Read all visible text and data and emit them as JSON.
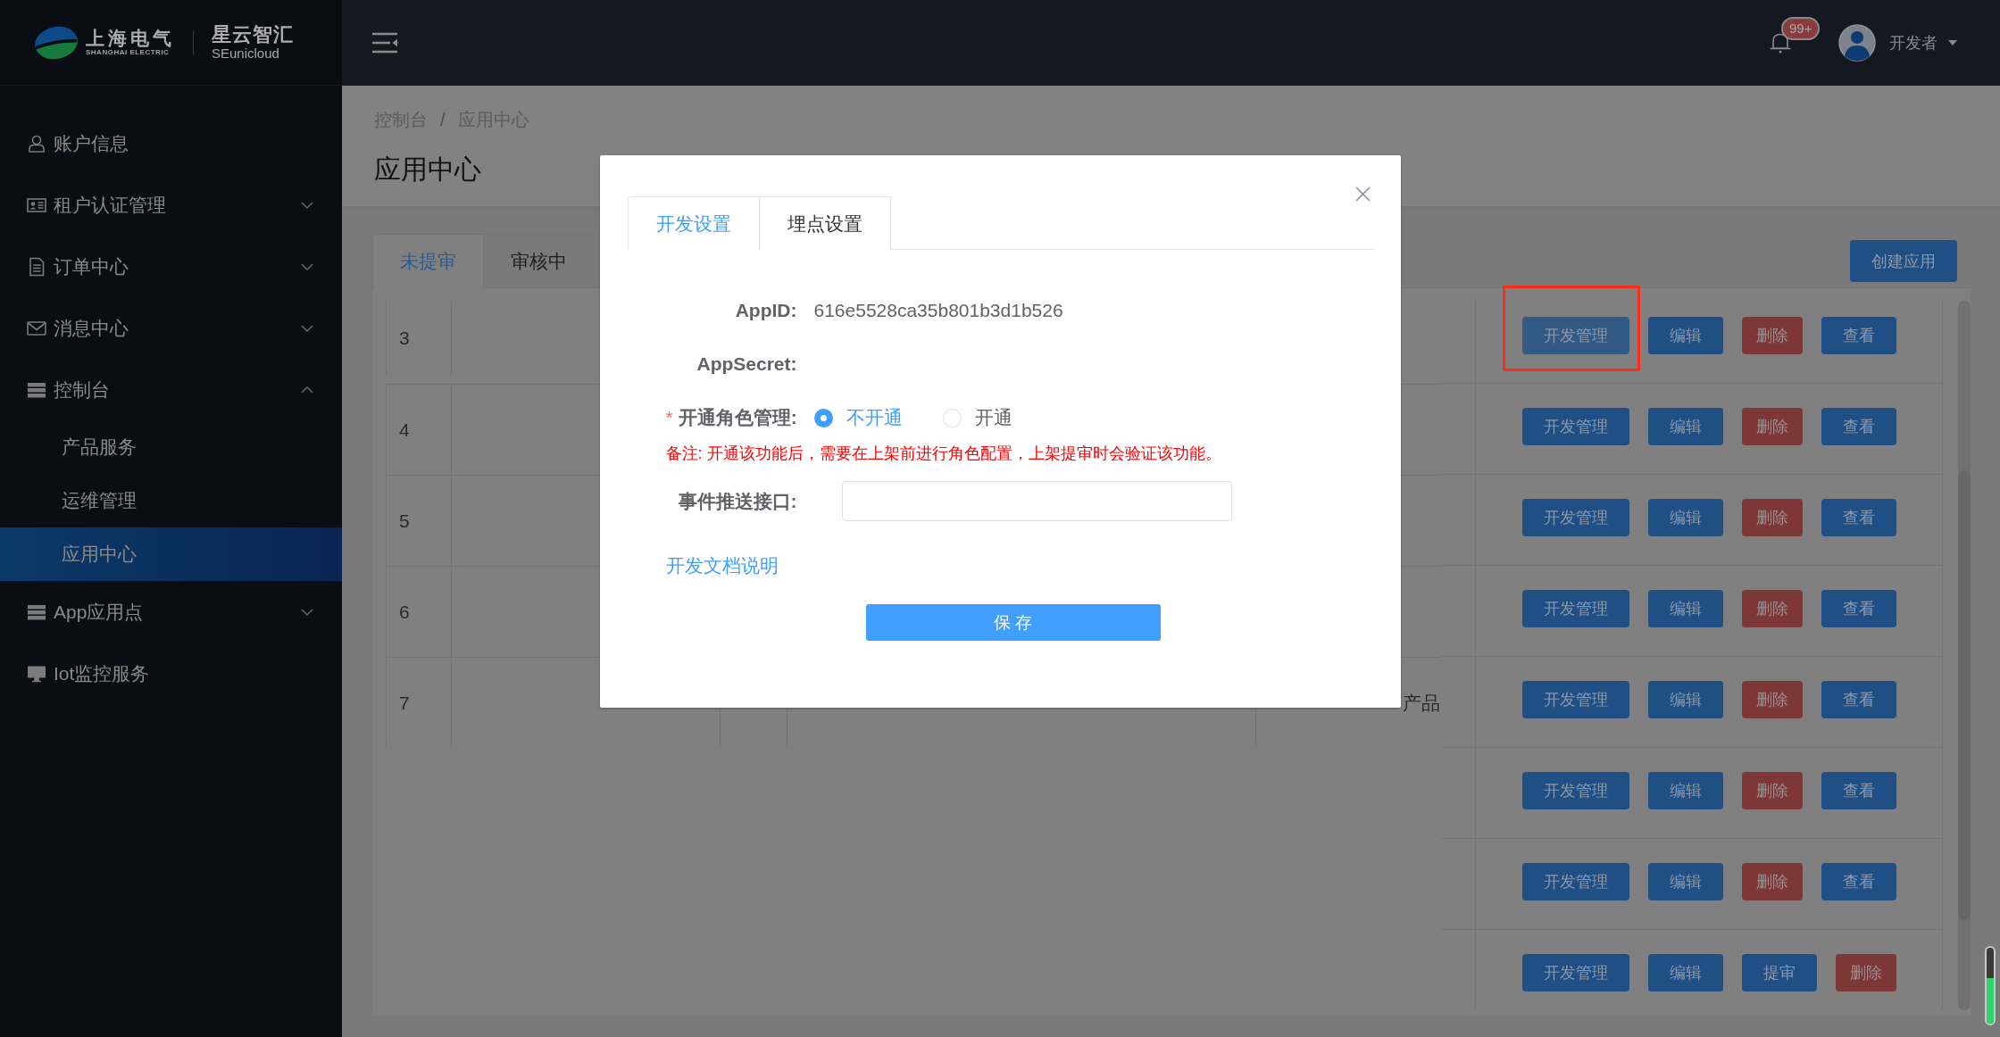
{
  "header": {
    "logo": {
      "brand": "上海电气",
      "brand_en": "SHANGHAI ELECTRIC",
      "product": "星云智汇",
      "product_en": "SEunicloud"
    },
    "notifications": {
      "badge": "99+"
    },
    "user": {
      "name": "开发者"
    }
  },
  "sidebar": {
    "items": [
      {
        "label": "账户信息",
        "kind": "link",
        "selected": false
      },
      {
        "label": "租户认证管理",
        "kind": "submenu",
        "expanded": false
      },
      {
        "label": "订单中心",
        "kind": "submenu",
        "expanded": false
      },
      {
        "label": "消息中心",
        "kind": "submenu",
        "expanded": false
      },
      {
        "label": "控制台",
        "kind": "submenu",
        "expanded": true,
        "children": [
          {
            "label": "产品服务",
            "selected": false
          },
          {
            "label": "运维管理",
            "selected": false
          },
          {
            "label": "应用中心",
            "selected": true
          }
        ]
      },
      {
        "label": "App应用点",
        "kind": "submenu",
        "expanded": false
      },
      {
        "label": "Iot监控服务",
        "kind": "link",
        "selected": false
      }
    ]
  },
  "breadcrumb": {
    "items": [
      "控制台",
      "应用中心"
    ],
    "separator": "/"
  },
  "page_title": "应用中心",
  "tabs": [
    {
      "label": "未提审",
      "selected": true
    },
    {
      "label": "审核中",
      "selected": false
    }
  ],
  "create_button": "创建应用",
  "table": {
    "rows": [
      {
        "column_1": "3"
      },
      {
        "column_1": "4"
      },
      {
        "column_1": "5"
      },
      {
        "column_1": "6"
      },
      {
        "column_1": "7",
        "column_5": "产品"
      }
    ],
    "action_rows": [
      {
        "actions": [
          {
            "label": "开发管理",
            "kind": "primary",
            "focused": true,
            "highlighted": true
          },
          {
            "label": "编辑",
            "kind": "primary",
            "focused": false,
            "highlighted": false
          },
          {
            "label": "删除",
            "kind": "danger",
            "focused": false,
            "highlighted": false
          },
          {
            "label": "查看",
            "kind": "primary",
            "focused": false,
            "highlighted": false
          }
        ]
      },
      {
        "actions": [
          {
            "label": "开发管理",
            "kind": "primary",
            "focused": false,
            "highlighted": false
          },
          {
            "label": "编辑",
            "kind": "primary",
            "focused": false,
            "highlighted": false
          },
          {
            "label": "删除",
            "kind": "danger",
            "focused": false,
            "highlighted": false
          },
          {
            "label": "查看",
            "kind": "primary",
            "focused": false,
            "highlighted": false
          }
        ]
      },
      {
        "actions": [
          {
            "label": "开发管理",
            "kind": "primary",
            "focused": false,
            "highlighted": false
          },
          {
            "label": "编辑",
            "kind": "primary",
            "focused": false,
            "highlighted": false
          },
          {
            "label": "删除",
            "kind": "danger",
            "focused": false,
            "highlighted": false
          },
          {
            "label": "查看",
            "kind": "primary",
            "focused": false,
            "highlighted": false
          }
        ]
      },
      {
        "actions": [
          {
            "label": "开发管理",
            "kind": "primary",
            "focused": false,
            "highlighted": false
          },
          {
            "label": "编辑",
            "kind": "primary",
            "focused": false,
            "highlighted": false
          },
          {
            "label": "删除",
            "kind": "danger",
            "focused": false,
            "highlighted": false
          },
          {
            "label": "查看",
            "kind": "primary",
            "focused": false,
            "highlighted": false
          }
        ]
      },
      {
        "actions": [
          {
            "label": "开发管理",
            "kind": "primary",
            "focused": false,
            "highlighted": false
          },
          {
            "label": "编辑",
            "kind": "primary",
            "focused": false,
            "highlighted": false
          },
          {
            "label": "删除",
            "kind": "danger",
            "focused": false,
            "highlighted": false
          },
          {
            "label": "查看",
            "kind": "primary",
            "focused": false,
            "highlighted": false
          }
        ]
      },
      {
        "actions": [
          {
            "label": "开发管理",
            "kind": "primary",
            "focused": false,
            "highlighted": false
          },
          {
            "label": "编辑",
            "kind": "primary",
            "focused": false,
            "highlighted": false
          },
          {
            "label": "删除",
            "kind": "danger",
            "focused": false,
            "highlighted": false
          },
          {
            "label": "查看",
            "kind": "primary",
            "focused": false,
            "highlighted": false
          }
        ]
      },
      {
        "actions": [
          {
            "label": "开发管理",
            "kind": "primary",
            "focused": false,
            "highlighted": false
          },
          {
            "label": "编辑",
            "kind": "primary",
            "focused": false,
            "highlighted": false
          },
          {
            "label": "删除",
            "kind": "danger",
            "focused": false,
            "highlighted": false
          },
          {
            "label": "查看",
            "kind": "primary",
            "focused": false,
            "highlighted": false
          }
        ]
      },
      {
        "actions": [
          {
            "label": "开发管理",
            "kind": "primary",
            "focused": false,
            "highlighted": false
          },
          {
            "label": "编辑",
            "kind": "primary",
            "focused": false,
            "highlighted": false
          },
          {
            "label": "提审",
            "kind": "primary",
            "focused": false,
            "highlighted": false
          },
          {
            "label": "删除",
            "kind": "danger",
            "focused": false,
            "highlighted": false
          }
        ]
      }
    ]
  },
  "dialog": {
    "tabs": [
      {
        "label": "开发设置",
        "selected": true
      },
      {
        "label": "埋点设置",
        "selected": false
      }
    ],
    "fields": [
      {
        "kind": "text",
        "label": "AppID:",
        "value": "616e5528ca35b801b3d1b526"
      },
      {
        "kind": "text",
        "label": "AppSecret:"
      },
      {
        "kind": "radio",
        "required_mark": "*",
        "label": "开通角色管理:",
        "options": [
          {
            "label": "不开通",
            "selected": true
          },
          {
            "label": "开通",
            "selected": false
          }
        ]
      },
      {
        "kind": "note",
        "text": "备注: 开通该功能后，需要在上架前进行角色配置，上架提审时会验证该功能。"
      },
      {
        "kind": "input",
        "label": "事件推送接口:"
      }
    ],
    "doc_link": "开发文档说明",
    "save_button": "保 存"
  },
  "side_meter": {
    "level": 0.6
  }
}
